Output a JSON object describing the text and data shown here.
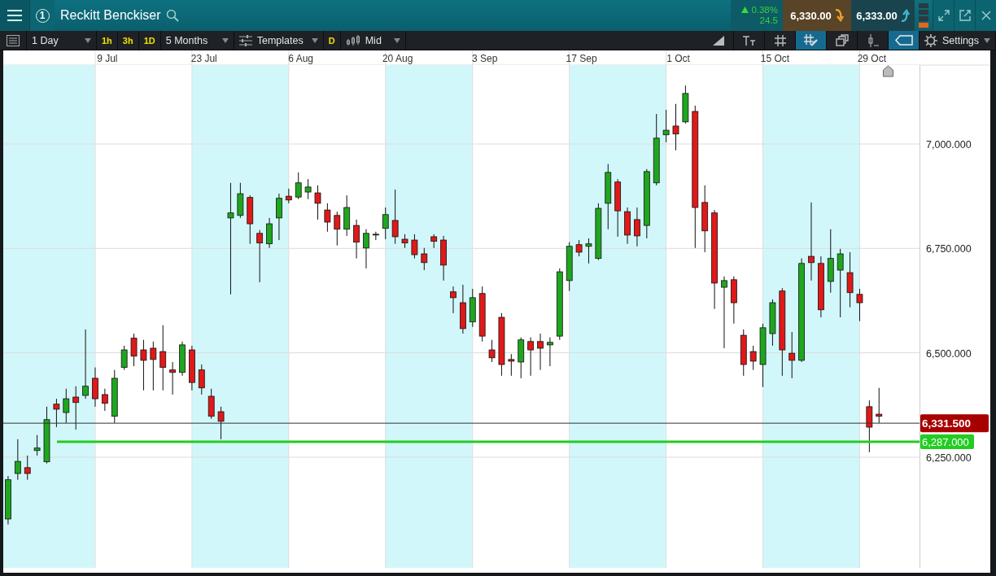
{
  "header": {
    "window_number": "1",
    "instrument": "Reckitt Benckiser",
    "change_percent": "0.38%",
    "change": "24.5",
    "sell_price": "6,330.00",
    "buy_price": "6,333.00"
  },
  "toolbar": {
    "interval": "1 Day",
    "quick_intervals": [
      "1h",
      "3h",
      "1D"
    ],
    "range": "5 Months",
    "templates": "Templates",
    "style_badge": "D",
    "price_type": "Mid",
    "settings": "Settings",
    "tool_buttons": [
      {
        "kind": "draw-line",
        "selected": false
      },
      {
        "kind": "text",
        "selected": false
      },
      {
        "kind": "grid",
        "selected": false
      },
      {
        "kind": "crosshair",
        "selected": true
      },
      {
        "kind": "layers",
        "selected": false
      },
      {
        "kind": "marker",
        "selected": false
      },
      {
        "kind": "tag",
        "selected": true
      }
    ]
  },
  "chart": {
    "chart_data": {
      "type": "candlestick",
      "categories": [
        null,
        null,
        null,
        null,
        null,
        null,
        null,
        null,
        null,
        null,
        "9 Jul",
        null,
        null,
        null,
        null,
        null,
        null,
        null,
        null,
        null,
        "23 Jul",
        null,
        null,
        null,
        null,
        null,
        null,
        null,
        null,
        null,
        "6 Aug",
        null,
        null,
        null,
        null,
        null,
        null,
        null,
        null,
        null,
        "20 Aug",
        null,
        null,
        null,
        null,
        null,
        null,
        null,
        null,
        "3 Sep",
        null,
        null,
        null,
        null,
        null,
        null,
        null,
        null,
        null,
        "17 Sep",
        null,
        null,
        null,
        null,
        null,
        null,
        null,
        null,
        null,
        "1 Oct",
        null,
        null,
        null,
        null,
        null,
        null,
        null,
        null,
        null,
        "15 Oct",
        null,
        null,
        null,
        null,
        null,
        null,
        null,
        null,
        null,
        "29 Oct",
        null,
        null,
        null,
        null,
        null,
        null,
        null,
        null,
        null,
        null,
        null,
        null
      ],
      "ohlc": [
        [
          6102,
          6205,
          6089,
          6196
        ],
        [
          6211,
          6293,
          6196,
          6240
        ],
        [
          6225,
          6254,
          6196,
          6211
        ],
        [
          6266,
          6303,
          6254,
          6272
        ],
        [
          6239,
          6371,
          6235,
          6340
        ],
        [
          6377,
          6390,
          6322,
          6365
        ],
        [
          6357,
          6414,
          6332,
          6390
        ],
        [
          6394,
          6420,
          6316,
          6381
        ],
        [
          6398,
          6556,
          6390,
          6420
        ],
        [
          6439,
          6465,
          6371,
          6390
        ],
        [
          6400,
          6414,
          6361,
          6379
        ],
        [
          6348,
          6459,
          6332,
          6439
        ],
        [
          6465,
          6517,
          6459,
          6507
        ],
        [
          6535,
          6546,
          6468,
          6492
        ],
        [
          6507,
          6531,
          6410,
          6482
        ],
        [
          6511,
          6527,
          6410,
          6484
        ],
        [
          6503,
          6566,
          6410,
          6465
        ],
        [
          6459,
          6478,
          6400,
          6453
        ],
        [
          6453,
          6527,
          6445,
          6519
        ],
        [
          6507,
          6517,
          6410,
          6429
        ],
        [
          6459,
          6472,
          6400,
          6416
        ],
        [
          6396,
          6414,
          6342,
          6348
        ],
        [
          6359,
          6371,
          6293,
          6336
        ],
        [
          6823,
          6907,
          6640,
          6835
        ],
        [
          6829,
          6907,
          6823,
          6881
        ],
        [
          6872,
          6877,
          6761,
          6809
        ],
        [
          6786,
          6794,
          6669,
          6763
        ],
        [
          6761,
          6823,
          6751,
          6809
        ],
        [
          6823,
          6881,
          6770,
          6870
        ],
        [
          6875,
          6893,
          6858,
          6866
        ],
        [
          6873,
          6932,
          6868,
          6907
        ],
        [
          6885,
          6916,
          6868,
          6897
        ],
        [
          6883,
          6901,
          6819,
          6858
        ],
        [
          6842,
          6858,
          6790,
          6813
        ],
        [
          6829,
          6838,
          6757,
          6796
        ],
        [
          6796,
          6877,
          6780,
          6848
        ],
        [
          6805,
          6819,
          6726,
          6765
        ],
        [
          6751,
          6796,
          6702,
          6786
        ],
        [
          6782,
          6790,
          6770,
          6784
        ],
        [
          6798,
          6848,
          6772,
          6831
        ],
        [
          6817,
          6891,
          6761,
          6778
        ],
        [
          6772,
          6784,
          6751,
          6763
        ],
        [
          6770,
          6784,
          6726,
          6735
        ],
        [
          6737,
          6751,
          6698,
          6716
        ],
        [
          6778,
          6784,
          6751,
          6767
        ],
        [
          6770,
          6780,
          6673,
          6710
        ],
        [
          6646,
          6659,
          6595,
          6632
        ],
        [
          6620,
          6663,
          6546,
          6558
        ],
        [
          6574,
          6653,
          6562,
          6632
        ],
        [
          6642,
          6659,
          6527,
          6540
        ],
        [
          6507,
          6531,
          6478,
          6488
        ],
        [
          6585,
          6595,
          6445,
          6472
        ],
        [
          6484,
          6497,
          6445,
          6480
        ],
        [
          6478,
          6537,
          6439,
          6531
        ],
        [
          6527,
          6537,
          6445,
          6507
        ],
        [
          6527,
          6546,
          6459,
          6511
        ],
        [
          6519,
          6537,
          6468,
          6525
        ],
        [
          6540,
          6702,
          6531,
          6694
        ],
        [
          6673,
          6765,
          6648,
          6755
        ],
        [
          6759,
          6770,
          6731,
          6741
        ],
        [
          6755,
          6774,
          6714,
          6761
        ],
        [
          6726,
          6858,
          6722,
          6846
        ],
        [
          6858,
          6952,
          6796,
          6932
        ],
        [
          6909,
          6916,
          6778,
          6840
        ],
        [
          6838,
          6848,
          6761,
          6782
        ],
        [
          6819,
          6848,
          6755,
          6780
        ],
        [
          6805,
          6940,
          6774,
          6934
        ],
        [
          6907,
          7072,
          6901,
          7014
        ],
        [
          7022,
          7082,
          7004,
          7033
        ],
        [
          7043,
          7096,
          6985,
          7024
        ],
        [
          7053,
          7140,
          7049,
          7121
        ],
        [
          7078,
          7092,
          6751,
          6848
        ],
        [
          6860,
          6901,
          6741,
          6792
        ],
        [
          6835,
          6842,
          6605,
          6667
        ],
        [
          6657,
          6683,
          6511,
          6673
        ],
        [
          6675,
          6683,
          6570,
          6620
        ],
        [
          6542,
          6556,
          6445,
          6472
        ],
        [
          6503,
          6517,
          6459,
          6480
        ],
        [
          6472,
          6570,
          6418,
          6560
        ],
        [
          6546,
          6628,
          6517,
          6620
        ],
        [
          6648,
          6655,
          6445,
          6507
        ],
        [
          6499,
          6550,
          6439,
          6482
        ],
        [
          6482,
          6726,
          6478,
          6714
        ],
        [
          6731,
          6860,
          6673,
          6716
        ],
        [
          6714,
          6731,
          6585,
          6603
        ],
        [
          6671,
          6796,
          6644,
          6726
        ],
        [
          6698,
          6749,
          6585,
          6737
        ],
        [
          6692,
          6741,
          6609,
          6644
        ],
        [
          6640,
          6653,
          6576,
          6620
        ],
        [
          6371,
          6386,
          6262,
          6322
        ],
        [
          6353,
          6416,
          6332,
          6348
        ],
        null,
        null,
        null,
        null,
        null,
        null,
        null,
        null,
        null,
        null,
        null
      ],
      "grid": true,
      "ylim": [
        5985,
        7189
      ],
      "yticks": [
        {
          "value": 7000,
          "label": "7,000.000"
        },
        {
          "value": 6750,
          "label": "6,750.000"
        },
        {
          "value": 6500,
          "label": "6,500.000"
        },
        {
          "value": 6250,
          "label": "6,250.000"
        }
      ],
      "ref_lines": [
        {
          "axis": "y",
          "value": 6331.5,
          "label": "6,331.500",
          "color": "#333333"
        },
        {
          "axis": "y",
          "value": 6287,
          "label": "6,287.000",
          "color": "#22cc22"
        }
      ]
    }
  }
}
